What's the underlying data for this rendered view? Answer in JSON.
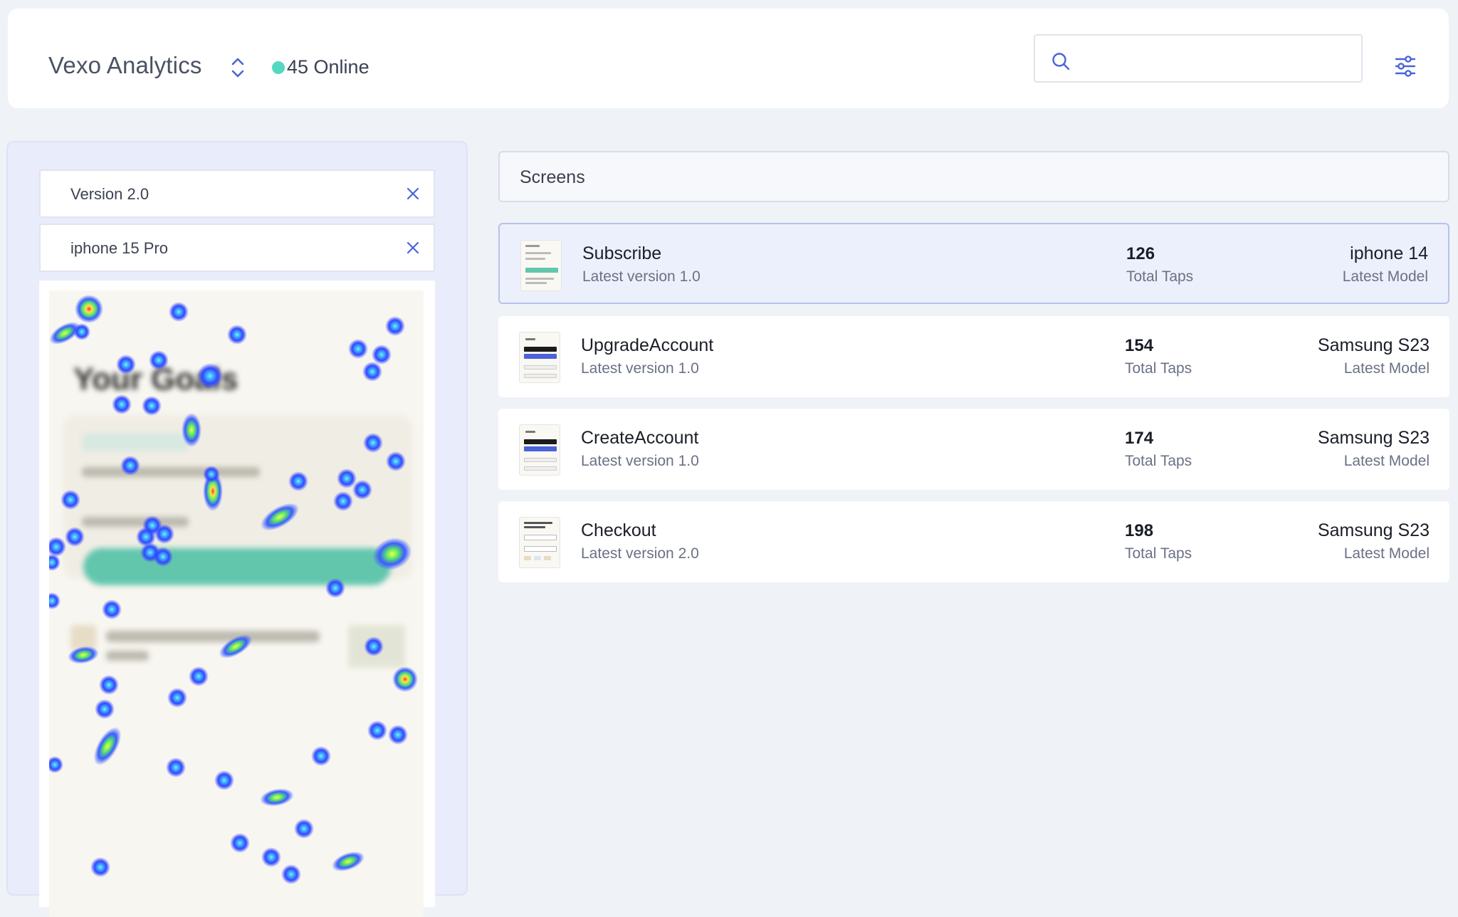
{
  "header": {
    "app_title": "Vexo Analytics",
    "online_count_label": "45 Online",
    "search": {
      "value": "",
      "placeholder": ""
    },
    "icons": [
      "chevron-up-down-icon",
      "search-icon",
      "sliders-icon"
    ],
    "status_color": "#55d8c1",
    "accent_color": "#4a63d8"
  },
  "filters": [
    {
      "label": "Version 2.0"
    },
    {
      "label": "iphone 15 Pro"
    }
  ],
  "heatmap": {
    "screen_title": "Your Goals"
  },
  "screens_section": {
    "title": "Screens"
  },
  "screens": [
    {
      "name": "Subscribe",
      "version": "Latest version 1.0",
      "taps": "126",
      "taps_label": "Total Taps",
      "model": "iphone 14",
      "model_label": "Latest Model",
      "selected": true
    },
    {
      "name": "UpgradeAccount",
      "version": "Latest version 1.0",
      "taps": "154",
      "taps_label": "Total Taps",
      "model": "Samsung S23",
      "model_label": "Latest Model",
      "selected": false
    },
    {
      "name": "CreateAccount",
      "version": "Latest version 1.0",
      "taps": "174",
      "taps_label": "Total Taps",
      "model": "Samsung S23",
      "model_label": "Latest Model",
      "selected": false
    },
    {
      "name": "Checkout",
      "version": "Latest version 2.0",
      "taps": "198",
      "taps_label": "Total Taps",
      "model": "Samsung S23",
      "model_label": "Latest Model",
      "selected": false
    }
  ]
}
